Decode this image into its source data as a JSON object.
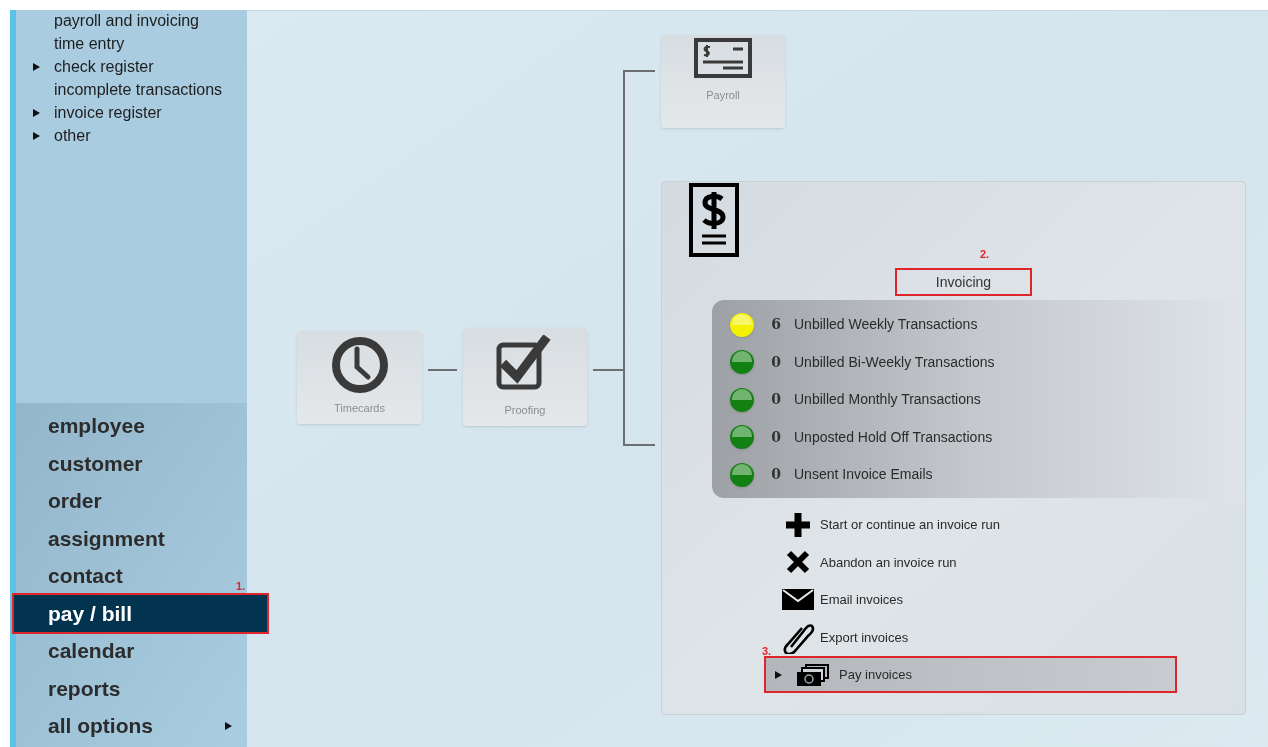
{
  "sidebar": {
    "links": [
      {
        "label": "payroll and invoicing",
        "expandable": false
      },
      {
        "label": "time entry",
        "expandable": false
      },
      {
        "label": "check register",
        "expandable": true
      },
      {
        "label": "incomplete transactions",
        "expandable": false
      },
      {
        "label": "invoice register",
        "expandable": true
      },
      {
        "label": "other",
        "expandable": true
      }
    ],
    "nav": [
      {
        "label": "employee",
        "selected": false,
        "has_submenu": false
      },
      {
        "label": "customer",
        "selected": false,
        "has_submenu": false
      },
      {
        "label": "order",
        "selected": false,
        "has_submenu": false
      },
      {
        "label": "assignment",
        "selected": false,
        "has_submenu": false
      },
      {
        "label": "contact",
        "selected": false,
        "has_submenu": false
      },
      {
        "label": "pay / bill",
        "selected": true,
        "has_submenu": false,
        "highlighted": true,
        "callout": "1."
      },
      {
        "label": "calendar",
        "selected": false,
        "has_submenu": false
      },
      {
        "label": "reports",
        "selected": false,
        "has_submenu": false
      },
      {
        "label": "all options",
        "selected": false,
        "has_submenu": true
      }
    ]
  },
  "workflow": {
    "steps": [
      {
        "kind": "timecards",
        "label": "Timecards"
      },
      {
        "kind": "proofing",
        "label": "Proofing"
      },
      {
        "kind": "payroll",
        "label": "Payroll"
      }
    ],
    "invoicing": {
      "title": "Invoicing",
      "highlighted": true,
      "callout": "2.",
      "statuses": [
        {
          "count": "6",
          "label": "Unbilled Weekly Transactions",
          "color": "#f2f200"
        },
        {
          "count": "0",
          "label": "Unbilled Bi-Weekly Transactions",
          "color": "#138013"
        },
        {
          "count": "0",
          "label": "Unbilled Monthly Transactions",
          "color": "#138013"
        },
        {
          "count": "0",
          "label": "Unposted Hold Off Transactions",
          "color": "#138013"
        },
        {
          "count": "0",
          "label": "Unsent Invoice Emails",
          "color": "#138013"
        }
      ],
      "actions": [
        {
          "kind": "plus",
          "label": "Start or continue an invoice run",
          "expandable": false,
          "highlighted": false
        },
        {
          "kind": "cross",
          "label": "Abandon an invoice run",
          "expandable": false,
          "highlighted": false
        },
        {
          "kind": "envelope",
          "label": "Email invoices",
          "expandable": false,
          "highlighted": false
        },
        {
          "kind": "paperclip",
          "label": "Export invoices",
          "expandable": false,
          "highlighted": false
        },
        {
          "kind": "cash",
          "label": "Pay invoices",
          "expandable": true,
          "highlighted": true,
          "callout": "3."
        }
      ]
    }
  }
}
